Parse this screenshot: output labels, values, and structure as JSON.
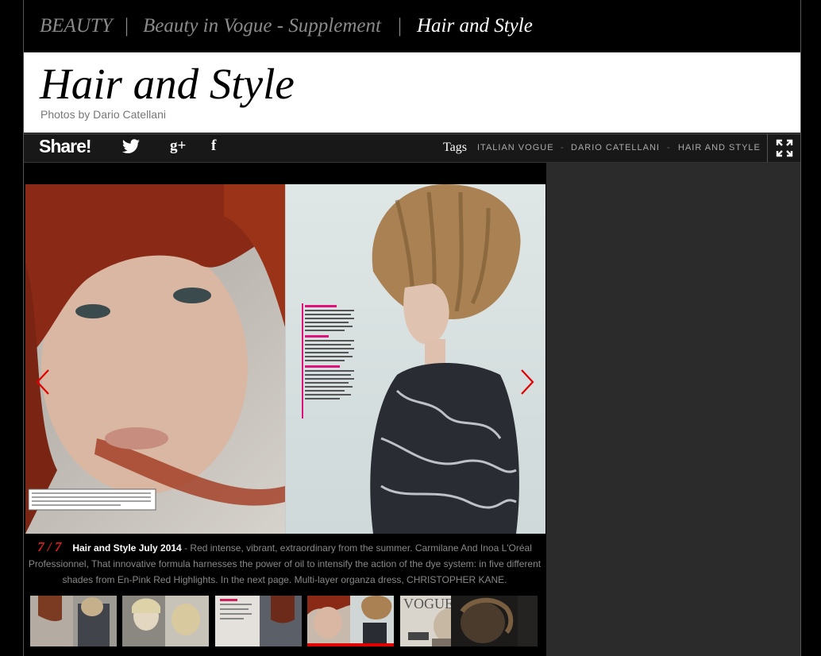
{
  "breadcrumb": {
    "items": [
      "BEAUTY",
      "Beauty in Vogue - Supplement",
      "Hair and Style"
    ],
    "separator": "|"
  },
  "header": {
    "title": "Hair and Style",
    "credit": "Photos by Dario Catellani"
  },
  "share": {
    "label": "Share!",
    "icons": [
      "twitter-icon",
      "google-plus-icon",
      "facebook-icon"
    ],
    "google_plus_glyph": "g+",
    "facebook_glyph": "f"
  },
  "tags": {
    "label": "Tags",
    "items": [
      "ITALIAN VOGUE",
      "DARIO CATELLANI",
      "HAIR AND STYLE"
    ],
    "separator": "-"
  },
  "gallery": {
    "counter": "7 / 7",
    "caption_title": "Hair and Style July 2014",
    "caption_text": " - Red intense, vibrant, extraordinary from the summer. Carmilane And Inoa L'Oréal Professionnel, That innovative formula harnesses the power of oil to intensify the action of the dye system: in five different shades from En-Pink Red Highlights. In the next page. Multi-layer organza dress, CHRISTOPHER KANE.",
    "thumbnail_count": 6,
    "active_thumbnail": 4,
    "accent_color": "#e10000"
  }
}
